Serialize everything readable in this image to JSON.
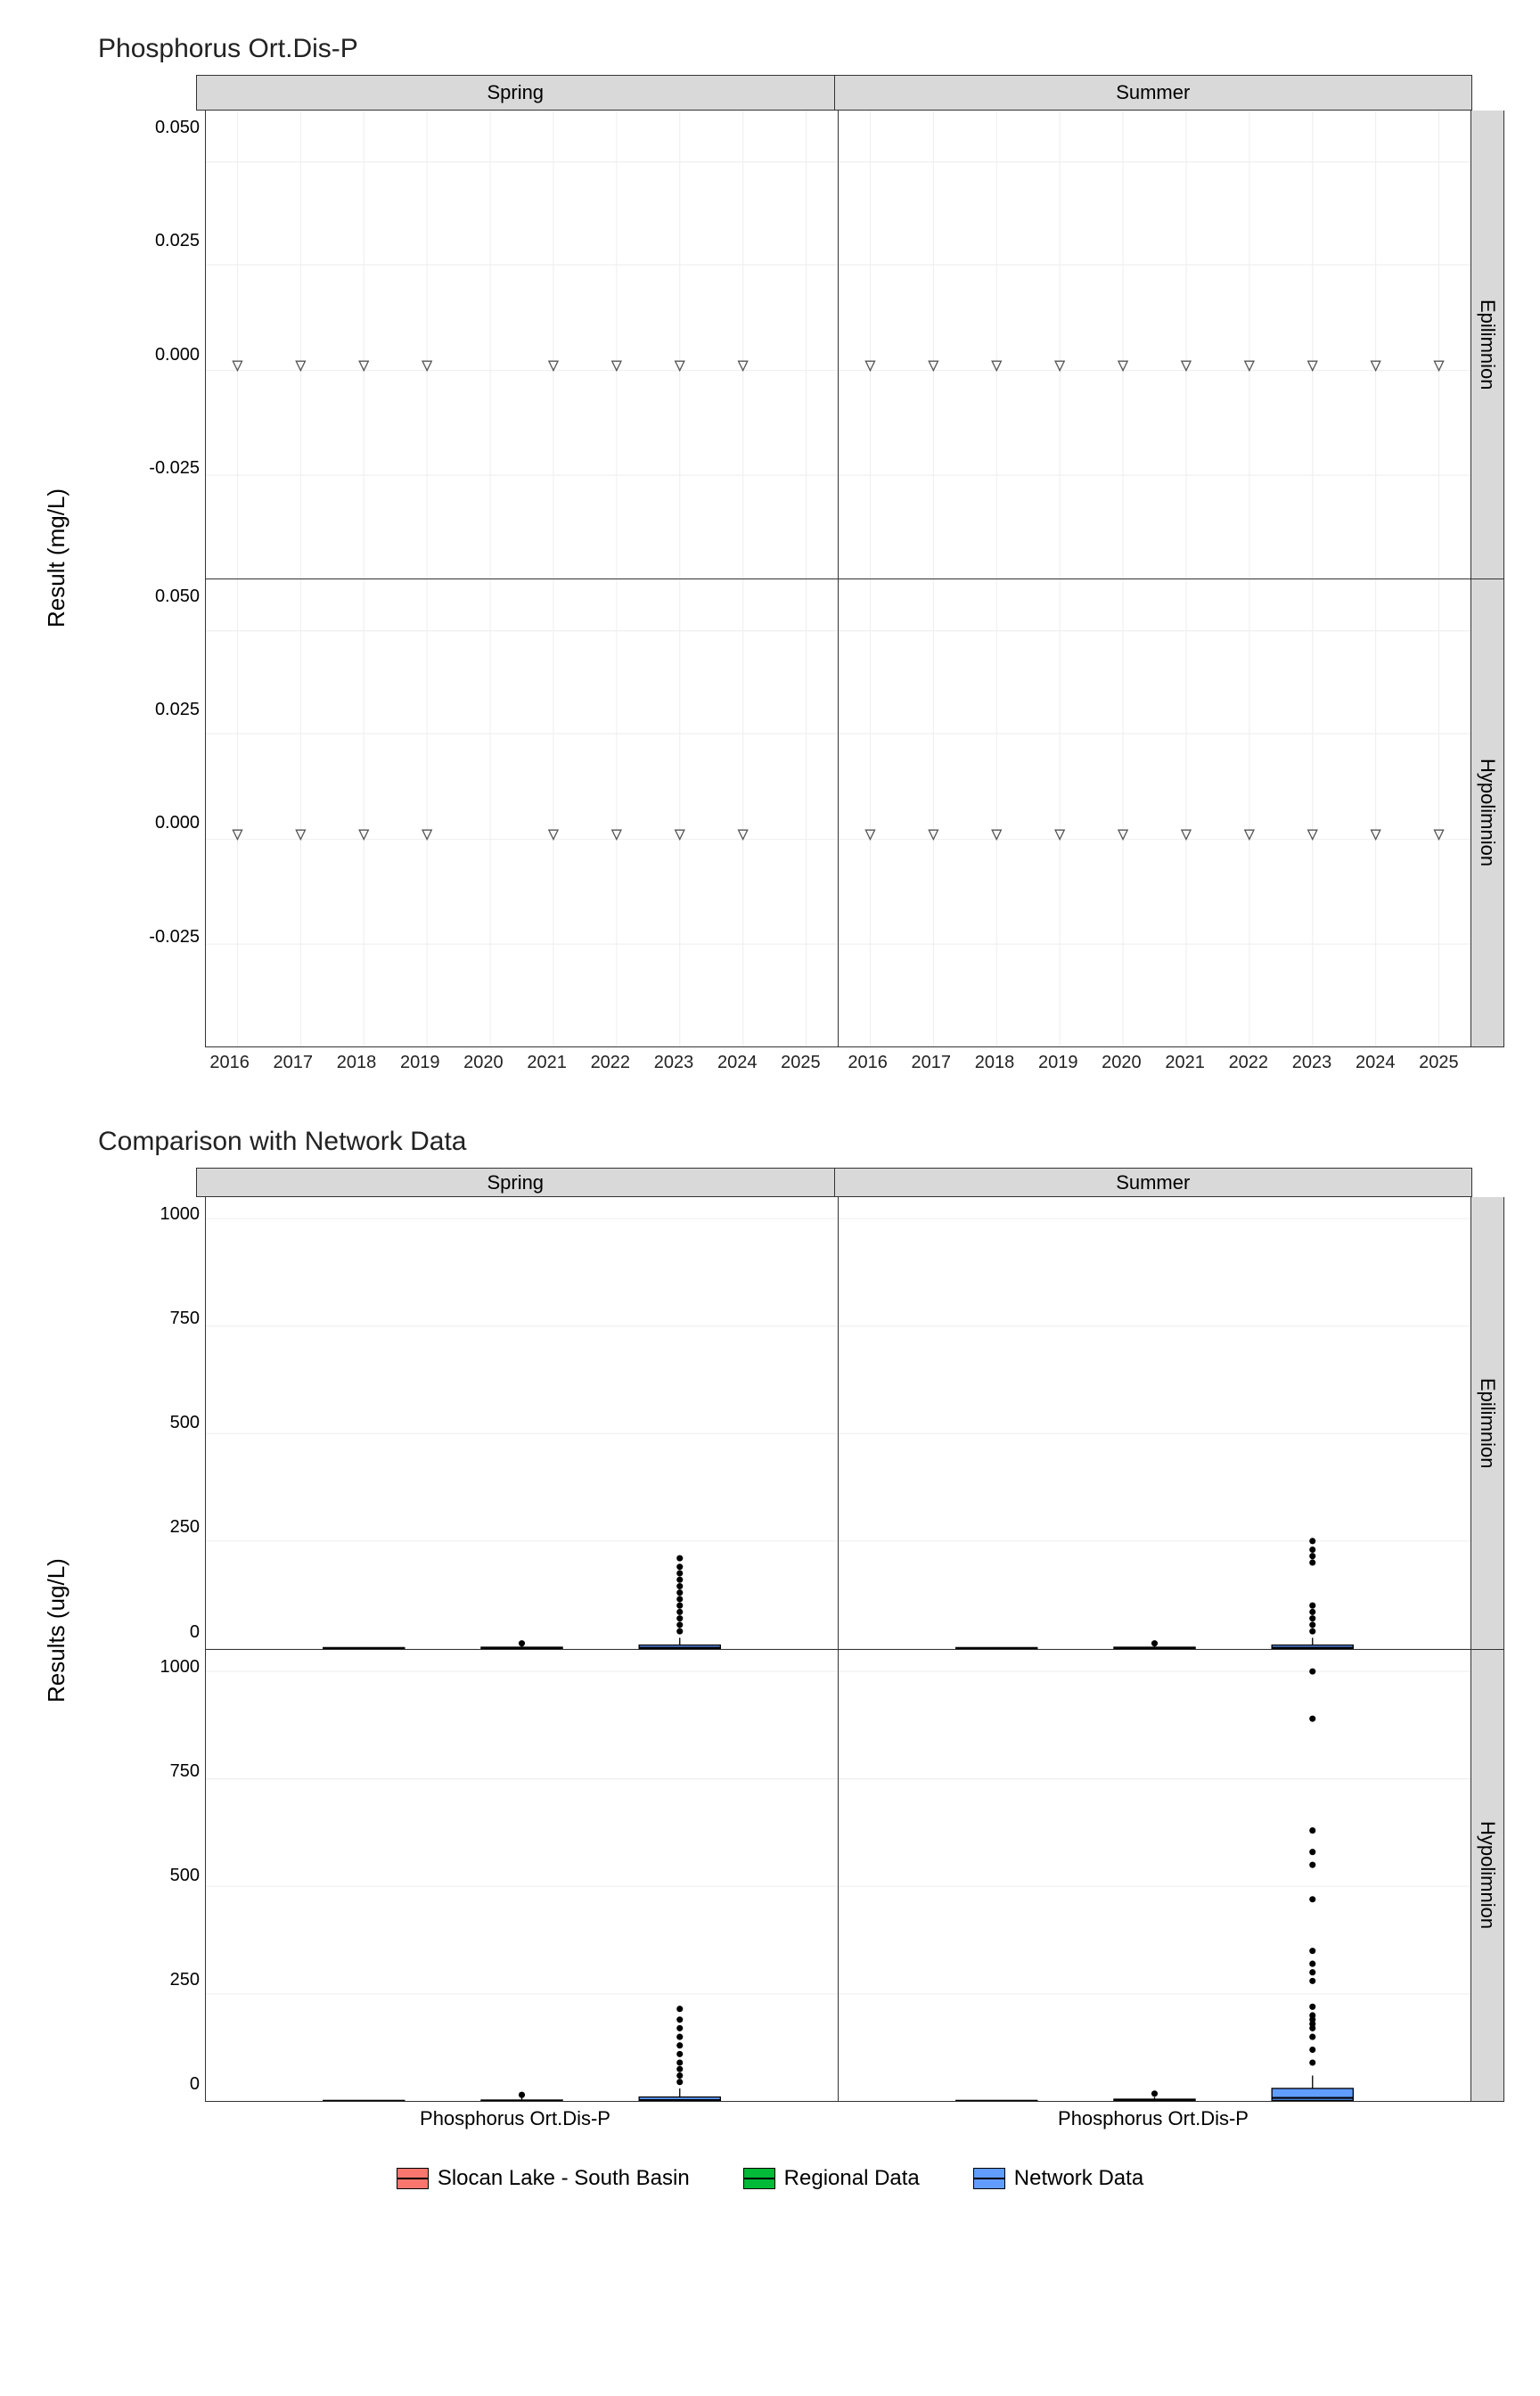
{
  "chart1": {
    "title": "Phosphorus Ort.Dis-P",
    "ylabel": "Result (mg/L)",
    "col_facets": [
      "Spring",
      "Summer"
    ],
    "row_facets": [
      "Epilimnion",
      "Hypolimnion"
    ],
    "y_ticks": [
      "0.050",
      "0.025",
      "0.000",
      "-0.025"
    ],
    "x_ticks": [
      "2016",
      "2017",
      "2018",
      "2019",
      "2020",
      "2021",
      "2022",
      "2023",
      "2024",
      "2025"
    ]
  },
  "chart2": {
    "title": "Comparison with Network Data",
    "ylabel": "Results (ug/L)",
    "col_facets": [
      "Spring",
      "Summer"
    ],
    "row_facets": [
      "Epilimnion",
      "Hypolimnion"
    ],
    "y_ticks": [
      "1000",
      "750",
      "500",
      "250",
      "0"
    ],
    "x_category": "Phosphorus Ort.Dis-P"
  },
  "legend": {
    "a": "Slocan Lake - South Basin",
    "b": "Regional Data",
    "c": "Network Data"
  },
  "chart_data": [
    {
      "type": "scatter",
      "title": "Phosphorus Ort.Dis-P",
      "ylabel": "Result (mg/L)",
      "xlabel": "",
      "facets_col": [
        "Spring",
        "Summer"
      ],
      "facets_row": [
        "Epilimnion",
        "Hypolimnion"
      ],
      "ylim": [
        -0.04,
        0.05
      ],
      "x": [
        2016,
        2017,
        2018,
        2019,
        2021,
        2022,
        2023,
        2024
      ],
      "note": "All visible points are plotted at ~0.001 mg/L (below detection markers, shown as open ▽).",
      "series": [
        {
          "name": "Spring · Epilimnion",
          "x": [
            2016,
            2017,
            2018,
            2019,
            2021,
            2022,
            2023,
            2024
          ],
          "y": [
            0.001,
            0.001,
            0.001,
            0.001,
            0.001,
            0.001,
            0.001,
            0.001
          ]
        },
        {
          "name": "Spring · Hypolimnion",
          "x": [
            2016,
            2017,
            2018,
            2019,
            2021,
            2022,
            2023,
            2024
          ],
          "y": [
            0.001,
            0.001,
            0.001,
            0.001,
            0.001,
            0.001,
            0.001,
            0.001
          ]
        },
        {
          "name": "Summer · Epilimnion",
          "x": [
            2016,
            2017,
            2018,
            2019,
            2020,
            2021,
            2022,
            2023,
            2024,
            2025
          ],
          "y": [
            0.001,
            0.001,
            0.001,
            0.001,
            0.001,
            0.001,
            0.001,
            0.001,
            0.001,
            0.001
          ]
        },
        {
          "name": "Summer · Hypolimnion",
          "x": [
            2016,
            2017,
            2018,
            2019,
            2020,
            2021,
            2022,
            2023,
            2024,
            2025
          ],
          "y": [
            0.001,
            0.001,
            0.001,
            0.001,
            0.001,
            0.001,
            0.001,
            0.001,
            0.001,
            0.001
          ]
        }
      ]
    },
    {
      "type": "boxplot",
      "title": "Comparison with Network Data",
      "ylabel": "Results (ug/L)",
      "xlabel": "",
      "facets_col": [
        "Spring",
        "Summer"
      ],
      "facets_row": [
        "Epilimnion",
        "Hypolimnion"
      ],
      "ylim": [
        0,
        1050
      ],
      "x_category": "Phosphorus Ort.Dis-P",
      "groups": [
        "Slocan Lake - South Basin",
        "Regional Data",
        "Network Data"
      ],
      "facet_data": {
        "Spring|Epilimnion": {
          "Slocan Lake - South Basin": {
            "min": 0,
            "q1": 0,
            "median": 1,
            "q3": 2,
            "max": 3,
            "outliers": []
          },
          "Regional Data": {
            "min": 0,
            "q1": 0,
            "median": 1,
            "q3": 3,
            "max": 6,
            "outliers": [
              12
            ]
          },
          "Network Data": {
            "min": 0,
            "q1": 0,
            "median": 2,
            "q3": 8,
            "max": 25,
            "outliers": [
              40,
              55,
              70,
              85,
              100,
              115,
              130,
              145,
              160,
              175,
              190,
              210
            ]
          }
        },
        "Summer|Epilimnion": {
          "Slocan Lake - South Basin": {
            "min": 0,
            "q1": 0,
            "median": 1,
            "q3": 2,
            "max": 3,
            "outliers": []
          },
          "Regional Data": {
            "min": 0,
            "q1": 0,
            "median": 1,
            "q3": 3,
            "max": 6,
            "outliers": [
              12
            ]
          },
          "Network Data": {
            "min": 0,
            "q1": 0,
            "median": 2,
            "q3": 8,
            "max": 25,
            "outliers": [
              40,
              55,
              70,
              85,
              100,
              200,
              215,
              230,
              250
            ]
          }
        },
        "Spring|Hypolimnion": {
          "Slocan Lake - South Basin": {
            "min": 0,
            "q1": 0,
            "median": 1,
            "q3": 2,
            "max": 3,
            "outliers": []
          },
          "Regional Data": {
            "min": 0,
            "q1": 0,
            "median": 1,
            "q3": 3,
            "max": 8,
            "outliers": [
              15
            ]
          },
          "Network Data": {
            "min": 0,
            "q1": 0,
            "median": 3,
            "q3": 10,
            "max": 30,
            "outliers": [
              45,
              60,
              75,
              90,
              110,
              130,
              150,
              170,
              190,
              215
            ]
          }
        },
        "Summer|Hypolimnion": {
          "Slocan Lake - South Basin": {
            "min": 0,
            "q1": 0,
            "median": 1,
            "q3": 2,
            "max": 3,
            "outliers": []
          },
          "Regional Data": {
            "min": 0,
            "q1": 0,
            "median": 2,
            "q3": 5,
            "max": 10,
            "outliers": [
              18
            ]
          },
          "Network Data": {
            "min": 0,
            "q1": 2,
            "median": 8,
            "q3": 30,
            "max": 60,
            "outliers": [
              90,
              120,
              150,
              170,
              180,
              190,
              200,
              220,
              280,
              300,
              320,
              350,
              470,
              550,
              580,
              630,
              890,
              1000
            ]
          }
        }
      }
    }
  ]
}
